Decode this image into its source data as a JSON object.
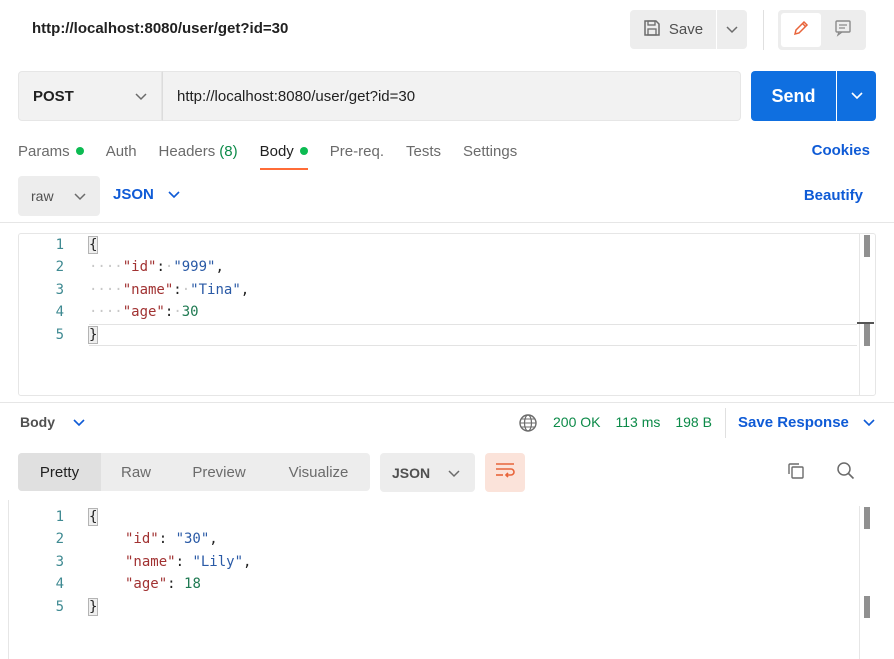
{
  "header": {
    "title": "http://localhost:8080/user/get?id=30",
    "save_label": "Save"
  },
  "request": {
    "method": "POST",
    "url": "http://localhost:8080/user/get?id=30",
    "send_label": "Send"
  },
  "tabs": [
    {
      "label": "Params",
      "dot": true
    },
    {
      "label": "Auth"
    },
    {
      "label": "Headers",
      "count": "(8)"
    },
    {
      "label": "Body",
      "dot": true,
      "active": true
    },
    {
      "label": "Pre-req."
    },
    {
      "label": "Tests"
    },
    {
      "label": "Settings"
    }
  ],
  "cookies_label": "Cookies",
  "body_type": {
    "mode": "raw",
    "format": "JSON",
    "beautify_label": "Beautify"
  },
  "request_body": {
    "line_numbers": [
      "1",
      "2",
      "3",
      "4",
      "5"
    ],
    "open_brace": "{",
    "close_brace": "}",
    "fields": [
      {
        "key": "\"id\"",
        "value": "\"999\"",
        "type": "string",
        "comma": ","
      },
      {
        "key": "\"name\"",
        "value": "\"Tina\"",
        "type": "string",
        "comma": ","
      },
      {
        "key": "\"age\"",
        "value": "30",
        "type": "number",
        "comma": ""
      }
    ]
  },
  "response": {
    "section_label": "Body",
    "status": "200 OK",
    "time": "113 ms",
    "size": "198 B",
    "save_label": "Save Response",
    "views": [
      "Pretty",
      "Raw",
      "Preview",
      "Visualize"
    ],
    "format": "JSON",
    "line_numbers": [
      "1",
      "2",
      "3",
      "4",
      "5"
    ],
    "open_brace": "{",
    "close_brace": "}",
    "fields": [
      {
        "key": "\"id\"",
        "value": "\"30\"",
        "type": "string",
        "comma": ","
      },
      {
        "key": "\"name\"",
        "value": "\"Lily\"",
        "type": "string",
        "comma": ","
      },
      {
        "key": "\"age\"",
        "value": "18",
        "type": "number",
        "comma": ""
      }
    ]
  },
  "colors": {
    "accent": "#0f6fe0",
    "link": "#0f5bd6",
    "active_tab": "#ff6c37",
    "status_ok": "#0c8a48",
    "dot": "#0cbb52"
  },
  "icons": [
    "save-icon",
    "chevron-down-icon",
    "pencil-icon",
    "comment-icon",
    "globe-icon",
    "wrap-lines-icon",
    "copy-icon",
    "search-icon"
  ]
}
